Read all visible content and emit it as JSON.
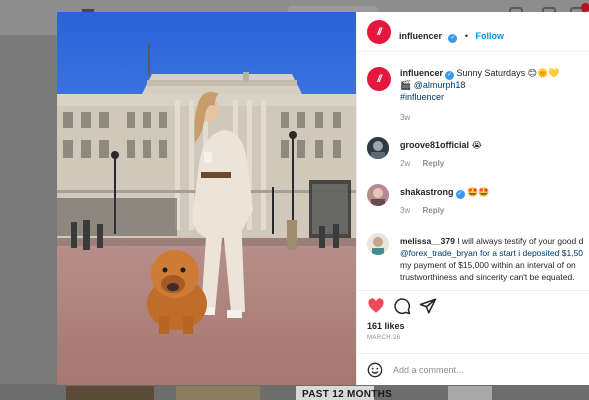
{
  "post": {
    "author": "influencer",
    "follow_label": "Follow",
    "avatar_text": "//",
    "caption": {
      "line1": "Sunny Saturdays 😊🌞💛",
      "line2_icon": "🎬",
      "line2_mention": "@almurph18",
      "line3_hashtag": "#influencer",
      "age": "3w"
    },
    "comments": [
      {
        "user": "groove81official",
        "text": "😭",
        "age": "2w",
        "reply": "Reply"
      },
      {
        "user": "shakastrong",
        "text": "🤩🤩",
        "age": "3w",
        "reply": "Reply"
      },
      {
        "user": "melissa__379",
        "lines": [
          "I will always testify of your good d",
          "@forex_trade_bryan for a start i deposited $1,50",
          "my payment of $15,000 within an interval of on",
          "trustworthiness and sincerity can't be equated."
        ]
      }
    ],
    "likes": "161 likes",
    "date": "MARCH 26",
    "add_comment_placeholder": "Add a comment..."
  },
  "background": {
    "banner_text": "PAST 12 MONTHS"
  },
  "icons": {
    "like": "heart-icon",
    "comment": "comment-icon",
    "share": "share-icon",
    "emoji": "emoji-icon",
    "verified": "verified-badge-icon"
  },
  "colors": {
    "brand": "#e6173c",
    "like": "#ed4956",
    "follow": "#0095f6",
    "link": "#00376b",
    "verified": "#3897f0"
  }
}
